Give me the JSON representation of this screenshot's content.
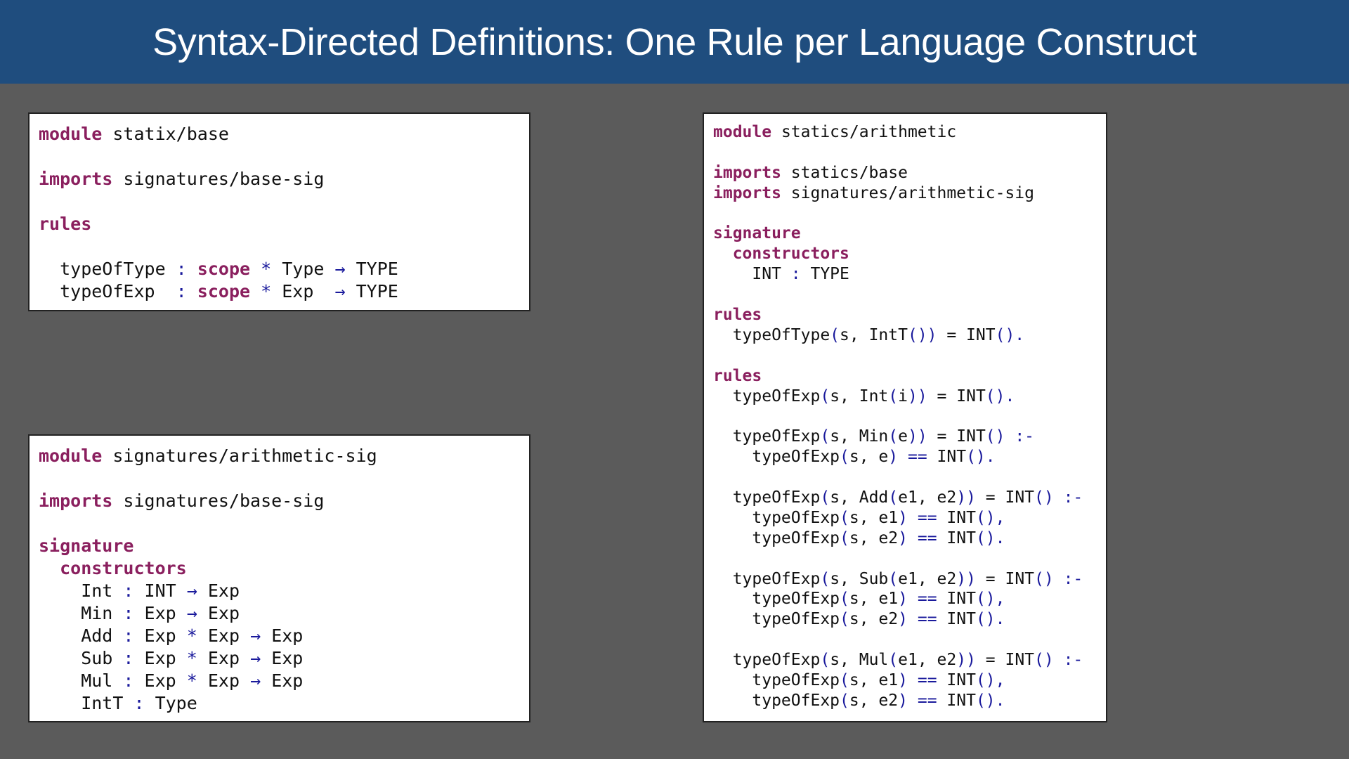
{
  "header": {
    "title": "Syntax-Directed Definitions: One Rule per Language Construct"
  },
  "colors": {
    "header_bg": "#1f4d7e",
    "background": "#5b5b5b",
    "keyword": "#8a1f5e",
    "operator": "#1a1a9c"
  },
  "panels": [
    {
      "name": "statix-base",
      "lines": [
        [
          [
            "kw",
            "module"
          ],
          [
            "pl",
            " statix/base"
          ]
        ],
        [],
        [
          [
            "kw",
            "imports"
          ],
          [
            "pl",
            " signatures/base-sig"
          ]
        ],
        [],
        [
          [
            "kw",
            "rules"
          ]
        ],
        [],
        [
          [
            "pl",
            "  typeOfType "
          ],
          [
            "op",
            ":"
          ],
          [
            "pl",
            " "
          ],
          [
            "kw",
            "scope"
          ],
          [
            "pl",
            " "
          ],
          [
            "op",
            "*"
          ],
          [
            "pl",
            " Type "
          ],
          [
            "op",
            "→"
          ],
          [
            "pl",
            " TYPE"
          ]
        ],
        [
          [
            "pl",
            "  typeOfExp  "
          ],
          [
            "op",
            ":"
          ],
          [
            "pl",
            " "
          ],
          [
            "kw",
            "scope"
          ],
          [
            "pl",
            " "
          ],
          [
            "op",
            "*"
          ],
          [
            "pl",
            " Exp  "
          ],
          [
            "op",
            "→"
          ],
          [
            "pl",
            " TYPE"
          ]
        ]
      ]
    },
    {
      "name": "arithmetic-sig",
      "lines": [
        [
          [
            "kw",
            "module"
          ],
          [
            "pl",
            " signatures/arithmetic-sig"
          ]
        ],
        [],
        [
          [
            "kw",
            "imports"
          ],
          [
            "pl",
            " signatures/base-sig"
          ]
        ],
        [],
        [
          [
            "kw",
            "signature"
          ]
        ],
        [
          [
            "kw",
            "  constructors"
          ]
        ],
        [
          [
            "pl",
            "    Int "
          ],
          [
            "op",
            ":"
          ],
          [
            "pl",
            " INT "
          ],
          [
            "op",
            "→"
          ],
          [
            "pl",
            " Exp"
          ]
        ],
        [
          [
            "pl",
            "    Min "
          ],
          [
            "op",
            ":"
          ],
          [
            "pl",
            " Exp "
          ],
          [
            "op",
            "→"
          ],
          [
            "pl",
            " Exp"
          ]
        ],
        [
          [
            "pl",
            "    Add "
          ],
          [
            "op",
            ":"
          ],
          [
            "pl",
            " Exp "
          ],
          [
            "op",
            "*"
          ],
          [
            "pl",
            " Exp "
          ],
          [
            "op",
            "→"
          ],
          [
            "pl",
            " Exp"
          ]
        ],
        [
          [
            "pl",
            "    Sub "
          ],
          [
            "op",
            ":"
          ],
          [
            "pl",
            " Exp "
          ],
          [
            "op",
            "*"
          ],
          [
            "pl",
            " Exp "
          ],
          [
            "op",
            "→"
          ],
          [
            "pl",
            " Exp"
          ]
        ],
        [
          [
            "pl",
            "    Mul "
          ],
          [
            "op",
            ":"
          ],
          [
            "pl",
            " Exp "
          ],
          [
            "op",
            "*"
          ],
          [
            "pl",
            " Exp "
          ],
          [
            "op",
            "→"
          ],
          [
            "pl",
            " Exp"
          ]
        ],
        [
          [
            "pl",
            "    IntT "
          ],
          [
            "op",
            ":"
          ],
          [
            "pl",
            " Type"
          ]
        ]
      ]
    },
    {
      "name": "statics-arithmetic",
      "lines": [
        [
          [
            "kw",
            "module"
          ],
          [
            "pl",
            " statics/arithmetic"
          ]
        ],
        [],
        [
          [
            "kw",
            "imports"
          ],
          [
            "pl",
            " statics/base"
          ]
        ],
        [
          [
            "kw",
            "imports"
          ],
          [
            "pl",
            " signatures/arithmetic-sig"
          ]
        ],
        [],
        [
          [
            "kw",
            "signature"
          ]
        ],
        [
          [
            "kw",
            "  constructors"
          ]
        ],
        [
          [
            "pl",
            "    INT "
          ],
          [
            "op",
            ":"
          ],
          [
            "pl",
            " TYPE"
          ]
        ],
        [],
        [
          [
            "kw",
            "rules"
          ]
        ],
        [
          [
            "pl",
            "  typeOfType"
          ],
          [
            "op",
            "("
          ],
          [
            "pl",
            "s, IntT"
          ],
          [
            "op",
            "())"
          ],
          [
            "pl",
            " = INT"
          ],
          [
            "op",
            "()."
          ]
        ],
        [],
        [
          [
            "kw",
            "rules"
          ]
        ],
        [
          [
            "pl",
            "  typeOfExp"
          ],
          [
            "op",
            "("
          ],
          [
            "pl",
            "s, Int"
          ],
          [
            "op",
            "("
          ],
          [
            "pl",
            "i"
          ],
          [
            "op",
            "))"
          ],
          [
            "pl",
            " = INT"
          ],
          [
            "op",
            "()."
          ]
        ],
        [],
        [
          [
            "pl",
            "  typeOfExp"
          ],
          [
            "op",
            "("
          ],
          [
            "pl",
            "s, Min"
          ],
          [
            "op",
            "("
          ],
          [
            "pl",
            "e"
          ],
          [
            "op",
            "))"
          ],
          [
            "pl",
            " = INT"
          ],
          [
            "op",
            "() :-"
          ]
        ],
        [
          [
            "pl",
            "    typeOfExp"
          ],
          [
            "op",
            "("
          ],
          [
            "pl",
            "s, e"
          ],
          [
            "op",
            ")"
          ],
          [
            "pl",
            " "
          ],
          [
            "op",
            "=="
          ],
          [
            "pl",
            " INT"
          ],
          [
            "op",
            "()."
          ]
        ],
        [],
        [
          [
            "pl",
            "  typeOfExp"
          ],
          [
            "op",
            "("
          ],
          [
            "pl",
            "s, Add"
          ],
          [
            "op",
            "("
          ],
          [
            "pl",
            "e1, e2"
          ],
          [
            "op",
            "))"
          ],
          [
            "pl",
            " = INT"
          ],
          [
            "op",
            "() :-"
          ]
        ],
        [
          [
            "pl",
            "    typeOfExp"
          ],
          [
            "op",
            "("
          ],
          [
            "pl",
            "s, e1"
          ],
          [
            "op",
            ")"
          ],
          [
            "pl",
            " "
          ],
          [
            "op",
            "=="
          ],
          [
            "pl",
            " INT"
          ],
          [
            "op",
            "(),"
          ]
        ],
        [
          [
            "pl",
            "    typeOfExp"
          ],
          [
            "op",
            "("
          ],
          [
            "pl",
            "s, e2"
          ],
          [
            "op",
            ")"
          ],
          [
            "pl",
            " "
          ],
          [
            "op",
            "=="
          ],
          [
            "pl",
            " INT"
          ],
          [
            "op",
            "()."
          ]
        ],
        [],
        [
          [
            "pl",
            "  typeOfExp"
          ],
          [
            "op",
            "("
          ],
          [
            "pl",
            "s, Sub"
          ],
          [
            "op",
            "("
          ],
          [
            "pl",
            "e1, e2"
          ],
          [
            "op",
            "))"
          ],
          [
            "pl",
            " = INT"
          ],
          [
            "op",
            "() :-"
          ]
        ],
        [
          [
            "pl",
            "    typeOfExp"
          ],
          [
            "op",
            "("
          ],
          [
            "pl",
            "s, e1"
          ],
          [
            "op",
            ")"
          ],
          [
            "pl",
            " "
          ],
          [
            "op",
            "=="
          ],
          [
            "pl",
            " INT"
          ],
          [
            "op",
            "(),"
          ]
        ],
        [
          [
            "pl",
            "    typeOfExp"
          ],
          [
            "op",
            "("
          ],
          [
            "pl",
            "s, e2"
          ],
          [
            "op",
            ")"
          ],
          [
            "pl",
            " "
          ],
          [
            "op",
            "=="
          ],
          [
            "pl",
            " INT"
          ],
          [
            "op",
            "()."
          ]
        ],
        [],
        [
          [
            "pl",
            "  typeOfExp"
          ],
          [
            "op",
            "("
          ],
          [
            "pl",
            "s, Mul"
          ],
          [
            "op",
            "("
          ],
          [
            "pl",
            "e1, e2"
          ],
          [
            "op",
            "))"
          ],
          [
            "pl",
            " = INT"
          ],
          [
            "op",
            "() :-"
          ]
        ],
        [
          [
            "pl",
            "    typeOfExp"
          ],
          [
            "op",
            "("
          ],
          [
            "pl",
            "s, e1"
          ],
          [
            "op",
            ")"
          ],
          [
            "pl",
            " "
          ],
          [
            "op",
            "=="
          ],
          [
            "pl",
            " INT"
          ],
          [
            "op",
            "(),"
          ]
        ],
        [
          [
            "pl",
            "    typeOfExp"
          ],
          [
            "op",
            "("
          ],
          [
            "pl",
            "s, e2"
          ],
          [
            "op",
            ")"
          ],
          [
            "pl",
            " "
          ],
          [
            "op",
            "=="
          ],
          [
            "pl",
            " INT"
          ],
          [
            "op",
            "()."
          ]
        ]
      ]
    }
  ]
}
